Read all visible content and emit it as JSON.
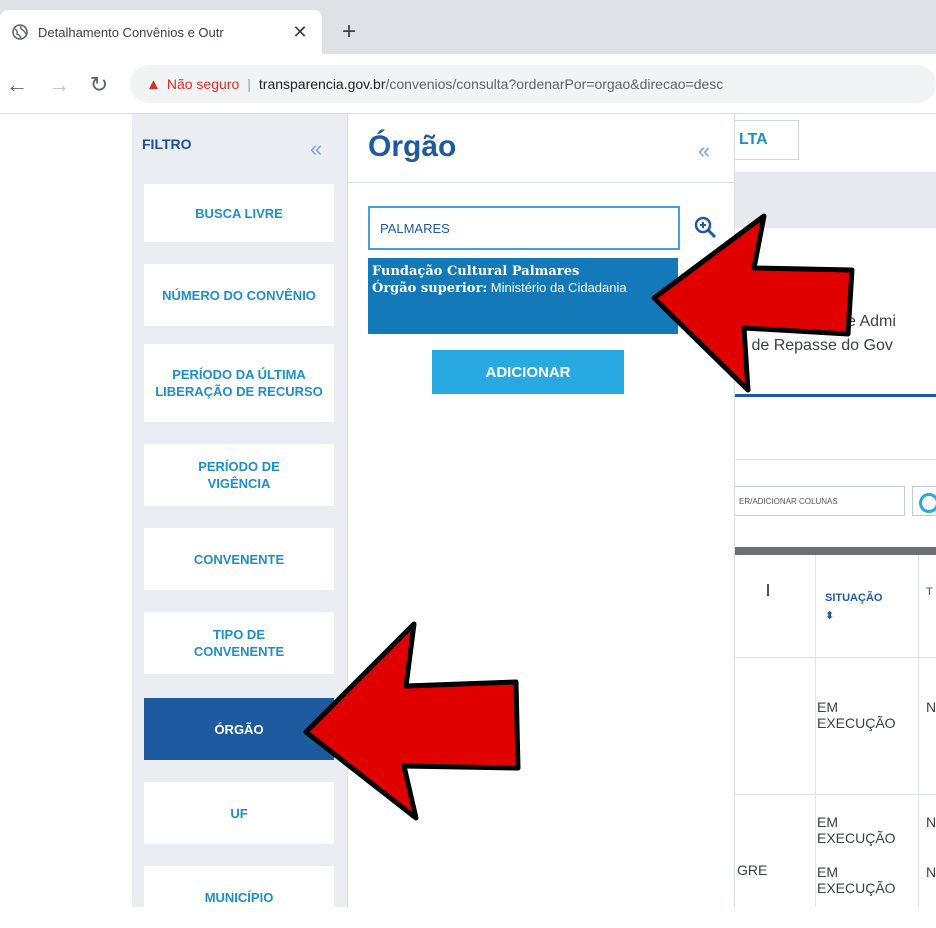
{
  "browser": {
    "tab_title": "Detalhamento Convênios e Outr",
    "new_tab": "+",
    "not_secure": "Não seguro",
    "separator": "|",
    "url_host": "transparencia.gov.br",
    "url_path": "/convenios/consulta?ordenarPor=orgao&direcao=desc"
  },
  "filter_sidebar": {
    "title": "FILTRO",
    "collapse": "«",
    "items": [
      {
        "label": "BUSCA LIVRE"
      },
      {
        "label": "NÚMERO DO CONVÊNIO"
      },
      {
        "label": "PERÍODO DA ÚLTIMA LIBERAÇÃO DE RECURSO"
      },
      {
        "label": "PERÍODO DE VIGÊNCIA"
      },
      {
        "label": "CONVENENTE"
      },
      {
        "label": "TIPO DE CONVENENTE"
      },
      {
        "label": "ÓRGÃO",
        "active": true
      },
      {
        "label": "UF"
      },
      {
        "label": "MUNICÍPIO"
      }
    ]
  },
  "orgao_panel": {
    "title": "Órgão",
    "collapse": "«",
    "search_value": "PALMARES",
    "suggestion": {
      "org_name": "Fundação Cultural Palmares",
      "superior_label": "Órgão superior:",
      "superior_value": "Ministério da Cidadania"
    },
    "add_button": "ADICIONAR"
  },
  "background": {
    "tab_fragment": "LTA",
    "desc_line1": "e Admi",
    "desc_line2": "s de Repasse do Gov",
    "columns_button": "ER/ADICIONAR COLUNAS",
    "table": {
      "header_situacao": "SITUAÇÃO",
      "sort_icon": "⬍",
      "header_next": "T",
      "rows": [
        {
          "situacao": "EM EXECUÇÃO",
          "next": "N"
        },
        {
          "situacao": "EM EXECUÇÃO",
          "next": "N"
        },
        {
          "situacao": "EM EXECUÇÃO",
          "next": "N",
          "left": "GRE"
        }
      ]
    }
  },
  "colors": {
    "accent_dark_blue": "#1e5aa0",
    "accent_light_blue": "#29a9e1",
    "suggestion_blue": "#1479b8",
    "arrow_red": "#e00000"
  }
}
